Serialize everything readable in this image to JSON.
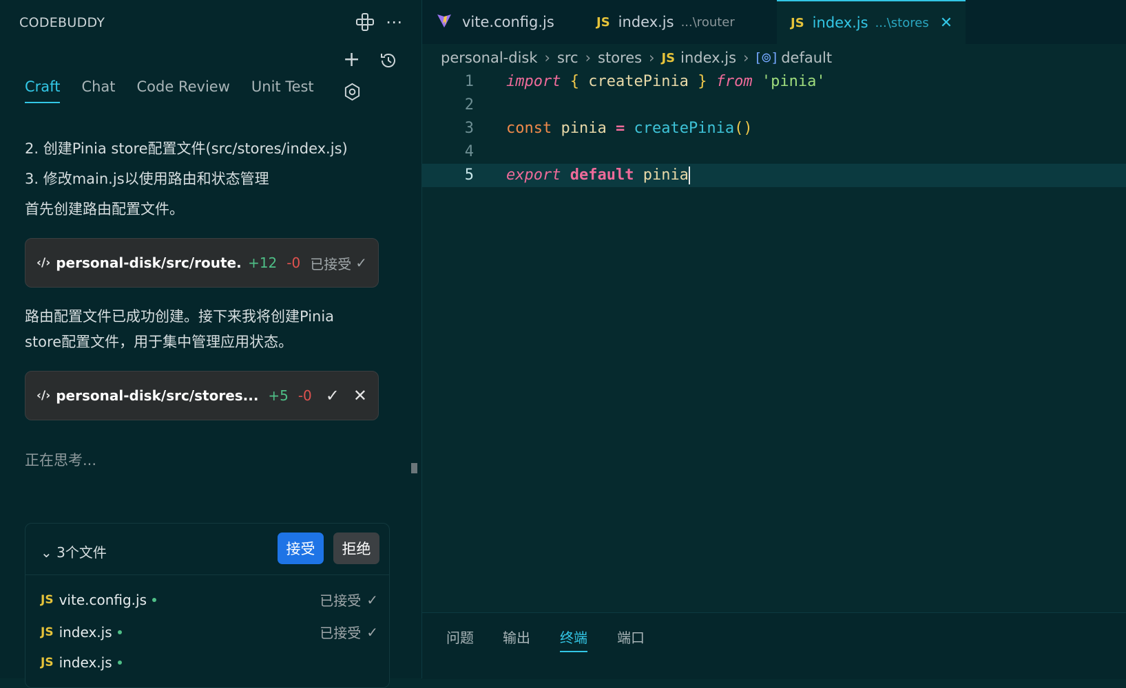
{
  "sidebar": {
    "title": "CODEBUDDY",
    "tabs": [
      "Craft",
      "Chat",
      "Code Review",
      "Unit Test"
    ],
    "messages": {
      "line1": "2. 创建Pinia store配置文件(src/stores/index.js)",
      "line2": "3. 修改main.js以使用路由和状态管理",
      "line3": "首先创建路由配置文件。",
      "para1_l1": "路由配置文件已成功创建。接下来我将创建Pinia",
      "para1_l2": "store配置文件，用于集中管理应用状态。",
      "thinking": "正在思考..."
    },
    "cards": [
      {
        "path": "personal-disk/src/route...",
        "plus": "+12",
        "minus": "-0",
        "status": "已接受"
      },
      {
        "path": "personal-disk/src/stores...",
        "plus": "+5",
        "minus": "-0"
      }
    ],
    "files": {
      "header": "3个文件",
      "accept": "接受",
      "reject": "拒绝",
      "items": [
        {
          "name": "vite.config.js",
          "status": "已接受"
        },
        {
          "name": "index.js",
          "status": "已接受"
        },
        {
          "name": "index.js",
          "status": ""
        }
      ]
    }
  },
  "editor": {
    "tabs": [
      {
        "name": "vite.config.js",
        "sub": ""
      },
      {
        "name": "index.js",
        "sub": "...\\router"
      },
      {
        "name": "index.js",
        "sub": "...\\stores"
      }
    ],
    "breadcrumb": [
      "personal-disk",
      "src",
      "stores",
      "index.js",
      "default"
    ],
    "line_numbers": [
      "1",
      "2",
      "3",
      "4",
      "5"
    ],
    "code": {
      "l1": {
        "import": "import",
        "open": "{",
        "name": "createPinia",
        "close": "}",
        "from": "from",
        "str": "'pinia'"
      },
      "l3": {
        "const": "const",
        "var": "pinia",
        "eq": "=",
        "fn": "createPinia",
        "parens": "()"
      },
      "l5": {
        "export": "export",
        "default": "default",
        "var": "pinia"
      }
    }
  },
  "panel": {
    "tabs": [
      "问题",
      "输出",
      "终端",
      "端口"
    ]
  },
  "icons": {
    "js": "JS",
    "vite": "vite-logo-icon"
  }
}
